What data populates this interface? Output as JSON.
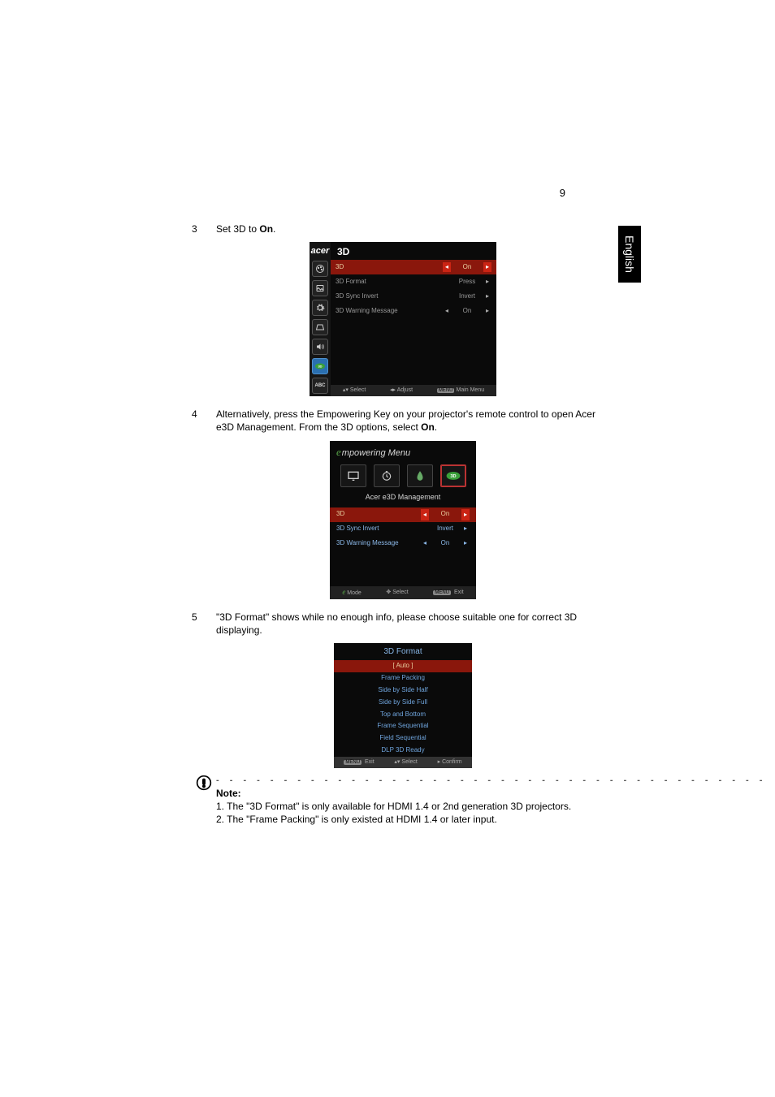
{
  "page_number": "9",
  "side_tab": "English",
  "steps": {
    "s3": {
      "num": "3",
      "text_a": "Set 3D to ",
      "text_b": "On",
      "text_c": "."
    },
    "s4": {
      "num": "4",
      "text_a": "Alternatively, press the Empowering Key on your projector's remote control to open Acer e3D Management. From the 3D options, select ",
      "text_b": "On",
      "text_c": "."
    },
    "s5": {
      "num": "5",
      "text": "\"3D Format\" shows while no enough info, please choose suitable one for correct 3D displaying."
    }
  },
  "osd1": {
    "logo": "acer",
    "title": "3D",
    "rows": [
      {
        "label": "3D",
        "val": "On",
        "selected": true,
        "hasL": true,
        "hasR": true
      },
      {
        "label": "3D Format",
        "val": "Press",
        "selected": false,
        "hasL": false,
        "hasR": true
      },
      {
        "label": "3D Sync Invert",
        "val": "Invert",
        "selected": false,
        "hasL": false,
        "hasR": true
      },
      {
        "label": "3D Warning Message",
        "val": "On",
        "selected": false,
        "hasL": true,
        "hasR": true
      }
    ],
    "foot": {
      "a": "Select",
      "b": "Adjust",
      "c": "Main Menu",
      "c_key": "MENU"
    }
  },
  "osd2": {
    "title_rest": "mpowering Menu",
    "subtitle": "Acer e3D Management",
    "rows": [
      {
        "label": "3D",
        "val": "On",
        "selected": true,
        "hasL": true,
        "hasR": true
      },
      {
        "label": "3D Sync Invert",
        "val": "Invert",
        "selected": false,
        "hasL": false,
        "hasR": true
      },
      {
        "label": "3D Warning Message",
        "val": "On",
        "selected": false,
        "hasL": true,
        "hasR": true
      }
    ],
    "foot": {
      "a": "Mode",
      "b": "Select",
      "c": "Exit",
      "c_key": "MENU"
    }
  },
  "osd3": {
    "title": "3D Format",
    "items": [
      {
        "label": "[ Auto ]",
        "selected": true
      },
      {
        "label": "Frame Packing",
        "selected": false
      },
      {
        "label": "Side by Side Half",
        "selected": false
      },
      {
        "label": "Side by Side Full",
        "selected": false
      },
      {
        "label": "Top and Bottom",
        "selected": false
      },
      {
        "label": "Frame Sequential",
        "selected": false
      },
      {
        "label": "Field Sequential",
        "selected": false
      },
      {
        "label": "DLP 3D Ready",
        "selected": false
      }
    ],
    "foot": {
      "a_key": "MENU",
      "a": "Exit",
      "b": "Select",
      "c": "Confirm"
    }
  },
  "note": {
    "heading": "Note:",
    "line1": "1. The \"3D Format\" is only available for HDMI 1.4 or 2nd generation 3D projectors.",
    "line2": "2. The \"Frame Packing\" is only existed at HDMI 1.4 or later input."
  }
}
